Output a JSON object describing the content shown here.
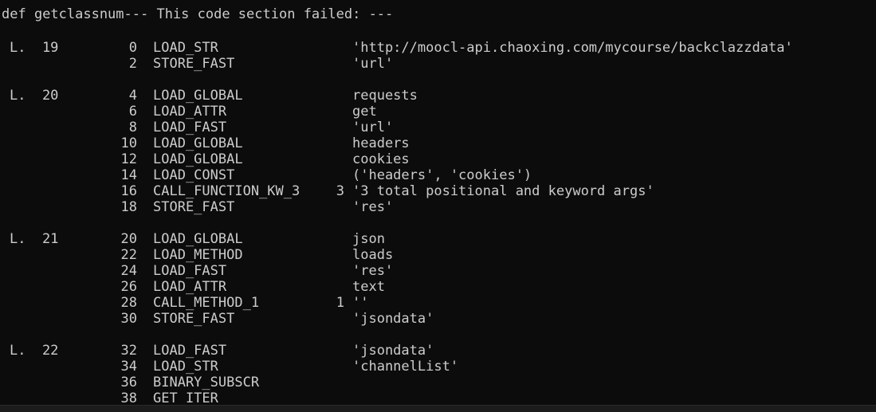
{
  "header": "def getclassnum--- This code section failed: ---",
  "rows": [
    {
      "lineno": "L.  19",
      "offset": "0",
      "opcode": "LOAD_STR",
      "oparg": "",
      "argrepr": "'http://moocl-api.chaoxing.com/mycourse/backclazzdata'"
    },
    {
      "lineno": "",
      "offset": "2",
      "opcode": "STORE_FAST",
      "oparg": "",
      "argrepr": "'url'"
    },
    {
      "lineno": "L.  20",
      "offset": "4",
      "opcode": "LOAD_GLOBAL",
      "oparg": "",
      "argrepr": "requests"
    },
    {
      "lineno": "",
      "offset": "6",
      "opcode": "LOAD_ATTR",
      "oparg": "",
      "argrepr": "get"
    },
    {
      "lineno": "",
      "offset": "8",
      "opcode": "LOAD_FAST",
      "oparg": "",
      "argrepr": "'url'"
    },
    {
      "lineno": "",
      "offset": "10",
      "opcode": "LOAD_GLOBAL",
      "oparg": "",
      "argrepr": "headers"
    },
    {
      "lineno": "",
      "offset": "12",
      "opcode": "LOAD_GLOBAL",
      "oparg": "",
      "argrepr": "cookies"
    },
    {
      "lineno": "",
      "offset": "14",
      "opcode": "LOAD_CONST",
      "oparg": "",
      "argrepr": "('headers', 'cookies')"
    },
    {
      "lineno": "",
      "offset": "16",
      "opcode": "CALL_FUNCTION_KW_3",
      "oparg": "3",
      "argrepr": "'3 total positional and keyword args'"
    },
    {
      "lineno": "",
      "offset": "18",
      "opcode": "STORE_FAST",
      "oparg": "",
      "argrepr": "'res'"
    },
    {
      "lineno": "L.  21",
      "offset": "20",
      "opcode": "LOAD_GLOBAL",
      "oparg": "",
      "argrepr": "json"
    },
    {
      "lineno": "",
      "offset": "22",
      "opcode": "LOAD_METHOD",
      "oparg": "",
      "argrepr": "loads"
    },
    {
      "lineno": "",
      "offset": "24",
      "opcode": "LOAD_FAST",
      "oparg": "",
      "argrepr": "'res'"
    },
    {
      "lineno": "",
      "offset": "26",
      "opcode": "LOAD_ATTR",
      "oparg": "",
      "argrepr": "text"
    },
    {
      "lineno": "",
      "offset": "28",
      "opcode": "CALL_METHOD_1",
      "oparg": "1",
      "argrepr": "''"
    },
    {
      "lineno": "",
      "offset": "30",
      "opcode": "STORE_FAST",
      "oparg": "",
      "argrepr": "'jsondata'"
    },
    {
      "lineno": "L.  22",
      "offset": "32",
      "opcode": "LOAD_FAST",
      "oparg": "",
      "argrepr": "'jsondata'"
    },
    {
      "lineno": "",
      "offset": "34",
      "opcode": "LOAD_STR",
      "oparg": "",
      "argrepr": "'channelList'"
    },
    {
      "lineno": "",
      "offset": "36",
      "opcode": "BINARY_SUBSCR",
      "oparg": "",
      "argrepr": ""
    },
    {
      "lineno": "",
      "offset": "38",
      "opcode": "GET_ITER",
      "oparg": "",
      "argrepr": ""
    }
  ]
}
